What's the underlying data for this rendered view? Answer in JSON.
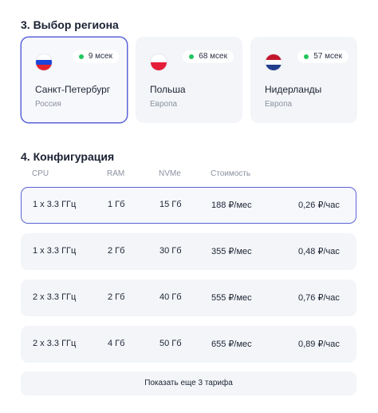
{
  "region_section": {
    "title": "3. Выбор региона",
    "regions": [
      {
        "name": "Санкт-Петербург",
        "area": "Россия",
        "ping": "9 мсек",
        "selected": true,
        "flag_colors": [
          "#ffffff",
          "#1c45d8",
          "#e4232c"
        ],
        "ping_color": "#22c55e"
      },
      {
        "name": "Польша",
        "area": "Европа",
        "ping": "68 мсек",
        "selected": false,
        "flag_colors": [
          "#ffffff",
          "#e41e38"
        ],
        "ping_color": "#22c55e"
      },
      {
        "name": "Нидерланды",
        "area": "Европа",
        "ping": "57 мсек",
        "selected": false,
        "flag_colors": [
          "#c4172c",
          "#ffffff",
          "#213e8c"
        ],
        "ping_color": "#22c55e"
      }
    ]
  },
  "config_section": {
    "title": "4. Конфигурация",
    "columns": {
      "cpu": "CPU",
      "ram": "RAM",
      "nvme": "NVMe",
      "price": "Стоимость"
    },
    "rows": [
      {
        "cpu": "1 x 3.3 ГГц",
        "ram": "1 Гб",
        "nvme": "15 Гб",
        "price": "188 ₽/мес",
        "hourly": "0,26 ₽/час",
        "selected": true
      },
      {
        "cpu": "1 x 3.3 ГГц",
        "ram": "2 Гб",
        "nvme": "30 Гб",
        "price": "355 ₽/мес",
        "hourly": "0,48 ₽/час",
        "selected": false
      },
      {
        "cpu": "2 x 3.3 ГГц",
        "ram": "2 Гб",
        "nvme": "40 Гб",
        "price": "555 ₽/мес",
        "hourly": "0,76 ₽/час",
        "selected": false
      },
      {
        "cpu": "2 x 3.3 ГГц",
        "ram": "4 Гб",
        "nvme": "50 Гб",
        "price": "655 ₽/мес",
        "hourly": "0,89 ₽/час",
        "selected": false
      }
    ],
    "more_button": "Показать еще 3 тарифа"
  },
  "colors": {
    "accent": "#5b63d6",
    "card_bg": "#f3f5f8",
    "muted_text": "#8a91a0"
  }
}
